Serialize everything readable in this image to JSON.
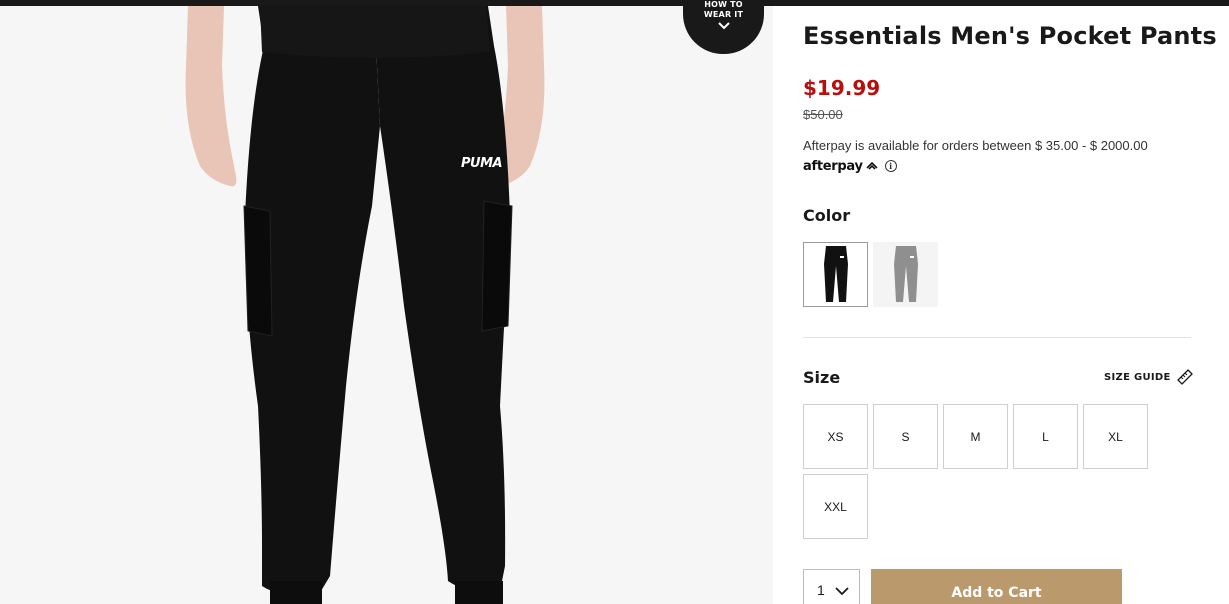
{
  "how_to_wear": {
    "line1": "HOW TO",
    "line2": "WEAR IT",
    "icon": "chevron-down-icon"
  },
  "product": {
    "title": "Essentials Men's Pocket Pants",
    "price": "$19.99",
    "original_price": "$50.00",
    "brand_logo_text": "PUMA"
  },
  "afterpay": {
    "text": "Afterpay is available for orders between $ 35.00 - $ 2000.00",
    "logo": "afterpay",
    "info_icon": "info-icon"
  },
  "color": {
    "label": "Color",
    "options": [
      {
        "name": "black",
        "hex": "#111111",
        "selected": true
      },
      {
        "name": "grey",
        "hex": "#8f8f8f",
        "selected": false
      }
    ]
  },
  "size": {
    "label": "Size",
    "guide_label": "SIZE GUIDE",
    "guide_icon": "ruler-icon",
    "options": [
      "XS",
      "S",
      "M",
      "L",
      "XL",
      "XXL"
    ]
  },
  "quantity": {
    "value": "1",
    "icon": "chevron-down-icon"
  },
  "actions": {
    "add_to_cart": "Add to Cart"
  },
  "colors": {
    "sale_price": "#ba0d0d",
    "cart_button": "#ba9a6d",
    "text": "#191919"
  }
}
